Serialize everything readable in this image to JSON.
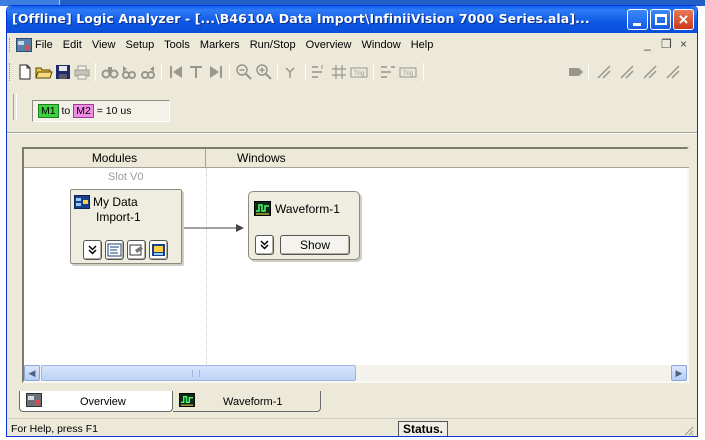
{
  "window": {
    "title": "[Offline] Logic Analyzer - [...\\B4610A Data Import\\InfiniiVision 7000 Series.ala]..."
  },
  "menubar": {
    "items": [
      "File",
      "Edit",
      "View",
      "Setup",
      "Tools",
      "Markers",
      "Run/Stop",
      "Overview",
      "Window",
      "Help"
    ],
    "mdi_min": "_",
    "mdi_restore": "❐",
    "mdi_close": "×"
  },
  "markers": {
    "m1": "M1",
    "to": "to",
    "m2": "M2",
    "value": "= 10 us"
  },
  "panel": {
    "modules_header": "Modules",
    "windows_header": "Windows",
    "slot_label": "Slot V0",
    "module_name_line1": "My Data",
    "module_name_line2": "Import-1",
    "window_name": "Waveform-1",
    "show_label": "Show"
  },
  "tabs": {
    "overview": "Overview",
    "waveform": "Waveform-1"
  },
  "statusbar": {
    "help": "For Help, press F1",
    "status": "Status."
  },
  "colors": {
    "title_blue": "#0a5ef2",
    "marker_m1": "#3ed23e",
    "marker_m2": "#f08ce6",
    "chrome": "#ece9d8"
  }
}
